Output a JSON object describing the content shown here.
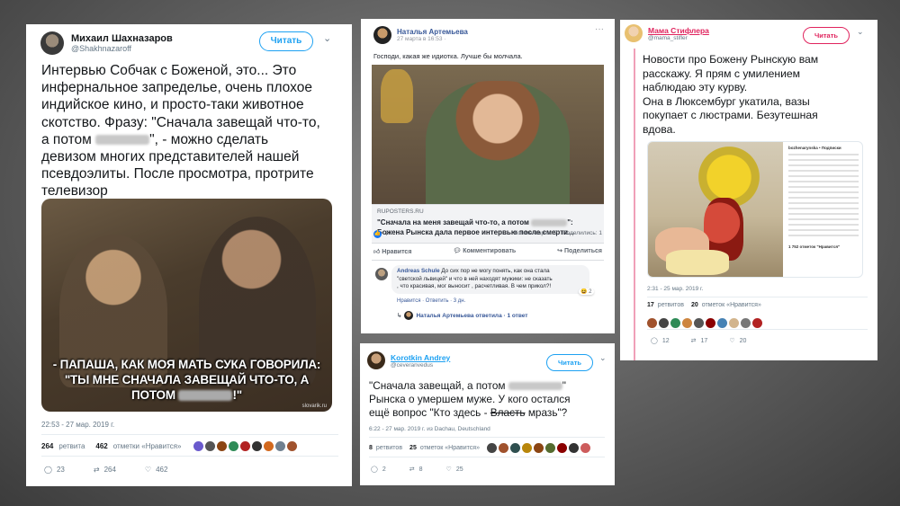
{
  "card1": {
    "name": "Михаил Шахназаров",
    "handle": "@Shakhnazaroff",
    "follow": "Читать",
    "text_line1": "Интервью Собчак с Боженой, это... Это",
    "text_line2": "инфернальное запределье, очень плохое",
    "text_line3": "индийское кино, и просто-таки животное",
    "text_line4": "скотство. Фразу: \"Сначала завещай что-то,",
    "text_line5a": "а потом",
    "text_line5b": "\", - можно сделать",
    "text_line6": "девизом многих представителей нашей",
    "text_line7": "псевдоэлиты. После просмотра, протрите",
    "text_line8": "телевизор",
    "meme_line1": "- ПАПАША, КАК МОЯ МАТЬ СУКА ГОВОРИЛА:",
    "meme_line2": "\"ТЫ МНЕ СНАЧАЛА ЗАВЕЩАЙ ЧТО-ТО, А",
    "meme_line3a": "ПОТОМ",
    "meme_line3b": "!\"",
    "watermark": "slovarik.ru",
    "timestamp": "22:53 - 27 мар. 2019 г.",
    "retweets_num": "264",
    "retweets_label": "ретвита",
    "likes_num": "462",
    "likes_label": "отметки «Нравится»",
    "reply_count": "23",
    "retweet_count": "264",
    "like_count": "462"
  },
  "card2": {
    "name": "Наталья Артемьева",
    "date": "27 марта в 16:53 ·",
    "text": "Господи, какая же идиотка. Лучше бы молчала.",
    "link_domain": "RUPOSTERS.RU",
    "link_title1a": "\"Сначала на меня завещай что-то, а потом",
    "link_title1b": "\":",
    "link_title2": "Божена Рынска дала первое интервью после смерти...",
    "reactions": "4",
    "comments_info": "Комментарии: 2   Поделились: 1",
    "like_btn": "Нравится",
    "comment_btn": "Комментировать",
    "share_btn": "Поделиться",
    "commenter": "Andreas Schule",
    "comment_l1": "До сих пор не могу понять, как она стала",
    "comment_l2": "\"светской львицей\" и что в ней находят мужики: не сказать",
    "comment_l3": ", что красивая, мог выносит , расчетливая. В чем прикол?!",
    "comment_reacts": "2",
    "comment_meta": "Нравится · Ответить · 3 дн.",
    "reply_info": "Наталья Артемьева ответила · 1 ответ"
  },
  "card3": {
    "name": "Мама Стифлера",
    "handle": "@mama_stifler",
    "follow": "Читать",
    "line1": "Новости про Божену Рынскую вам",
    "line2": "расскажу. Я прям с умилением",
    "line3": "наблюдаю эту курву.",
    "line4": "Она в Люксембург укатила, вазы",
    "line5": "покупает с люстрами. Безутешная",
    "line6": "вдова.",
    "screenshot_user": "bozhenarynska • Подписки",
    "screenshot_likes": "1 752 отметок \"Нравится\"",
    "timestamp": "2:31 - 25 мар. 2019 г.",
    "retweets_num": "17",
    "retweets_label": "ретвитов",
    "likes_num": "20",
    "likes_label": "отметок «Нравится»",
    "reply_count": "12",
    "retweet_count": "17",
    "like_count": "20"
  },
  "card4": {
    "name": "Korotkin Andrey",
    "handle": "@ceveranvedus",
    "follow": "Читать",
    "line1a": "\"Сначала завещай, а потом",
    "line1b": "\"",
    "line2": "Рынска о умершем муже. У кого остался",
    "line3a": "ещё вопрос \"Кто здесь - ",
    "line3b": "Власть",
    "line3c": " мразь\"?",
    "timestamp": "6:22 - 27 мар. 2019 г. из Dachau, Deutschland",
    "retweets_num": "8",
    "retweets_label": "ретвитов",
    "likes_num": "25",
    "likes_label": "отметок «Нравится»",
    "reply_count": "2",
    "retweet_count": "8",
    "like_count": "25"
  },
  "colors": {
    "twitter_blue": "#1da1f2",
    "facebook_blue": "#385898",
    "pink_follow": "#e0245e",
    "meta_gray": "#657786"
  }
}
